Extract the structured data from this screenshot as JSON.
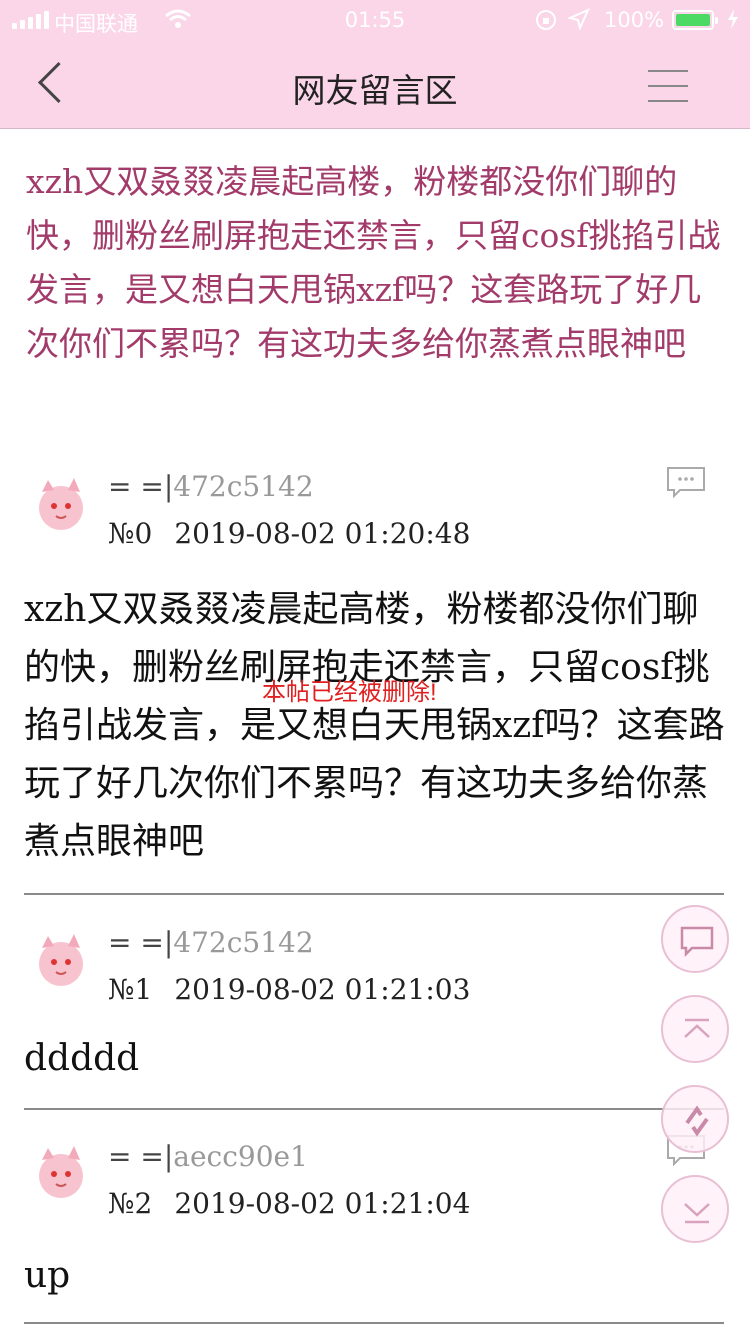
{
  "status_bar": {
    "carrier": "中国联通",
    "time": "01:55",
    "battery": "100%"
  },
  "header": {
    "title": "网友留言区"
  },
  "lead_text": "xzh又双叒叕凌晨起高楼，粉楼都没你们聊的快，删粉丝刷屏抱走还禁言，只留cosf挑掐引战发言，是又想白天甩锅xzf吗？这套路玩了好几次你们不累吗？有这功夫多给你蒸煮点眼神吧",
  "posts": [
    {
      "name_prefix": "= =|",
      "user_id": "472c5142",
      "floor": "№0",
      "date": "2019-08-02 01:20:48",
      "text": "xzh又双叒叕凌晨起高楼，粉楼都没你们聊的快，删粉丝刷屏抱走还禁言，只留cosf挑掐引战发言，是又想白天甩锅xzf吗？这套路玩了好几次你们不累吗？有这功夫多给你蒸煮点眼神吧"
    },
    {
      "name_prefix": "= =|",
      "user_id": "472c5142",
      "floor": "№1",
      "date": "2019-08-02 01:21:03",
      "text": "ddddd"
    },
    {
      "name_prefix": "= =|",
      "user_id": "aecc90e1",
      "floor": "№2",
      "date": "2019-08-02 01:21:04",
      "text": "up"
    }
  ],
  "deleted_notice": "本帖已经被删除!",
  "icons": {
    "back": "chevron-left-icon",
    "menu": "hamburger-menu-icon",
    "comment": "comment-bubble-icon",
    "scroll_top": "scroll-to-top-icon",
    "refresh": "refresh-icon",
    "scroll_bottom": "scroll-to-bottom-icon"
  },
  "colors": {
    "header_bg": "#fbd6e8",
    "lead_text": "#a23b6a",
    "deleted_notice": "#e02020",
    "fab_border": "#e8bfd3"
  }
}
